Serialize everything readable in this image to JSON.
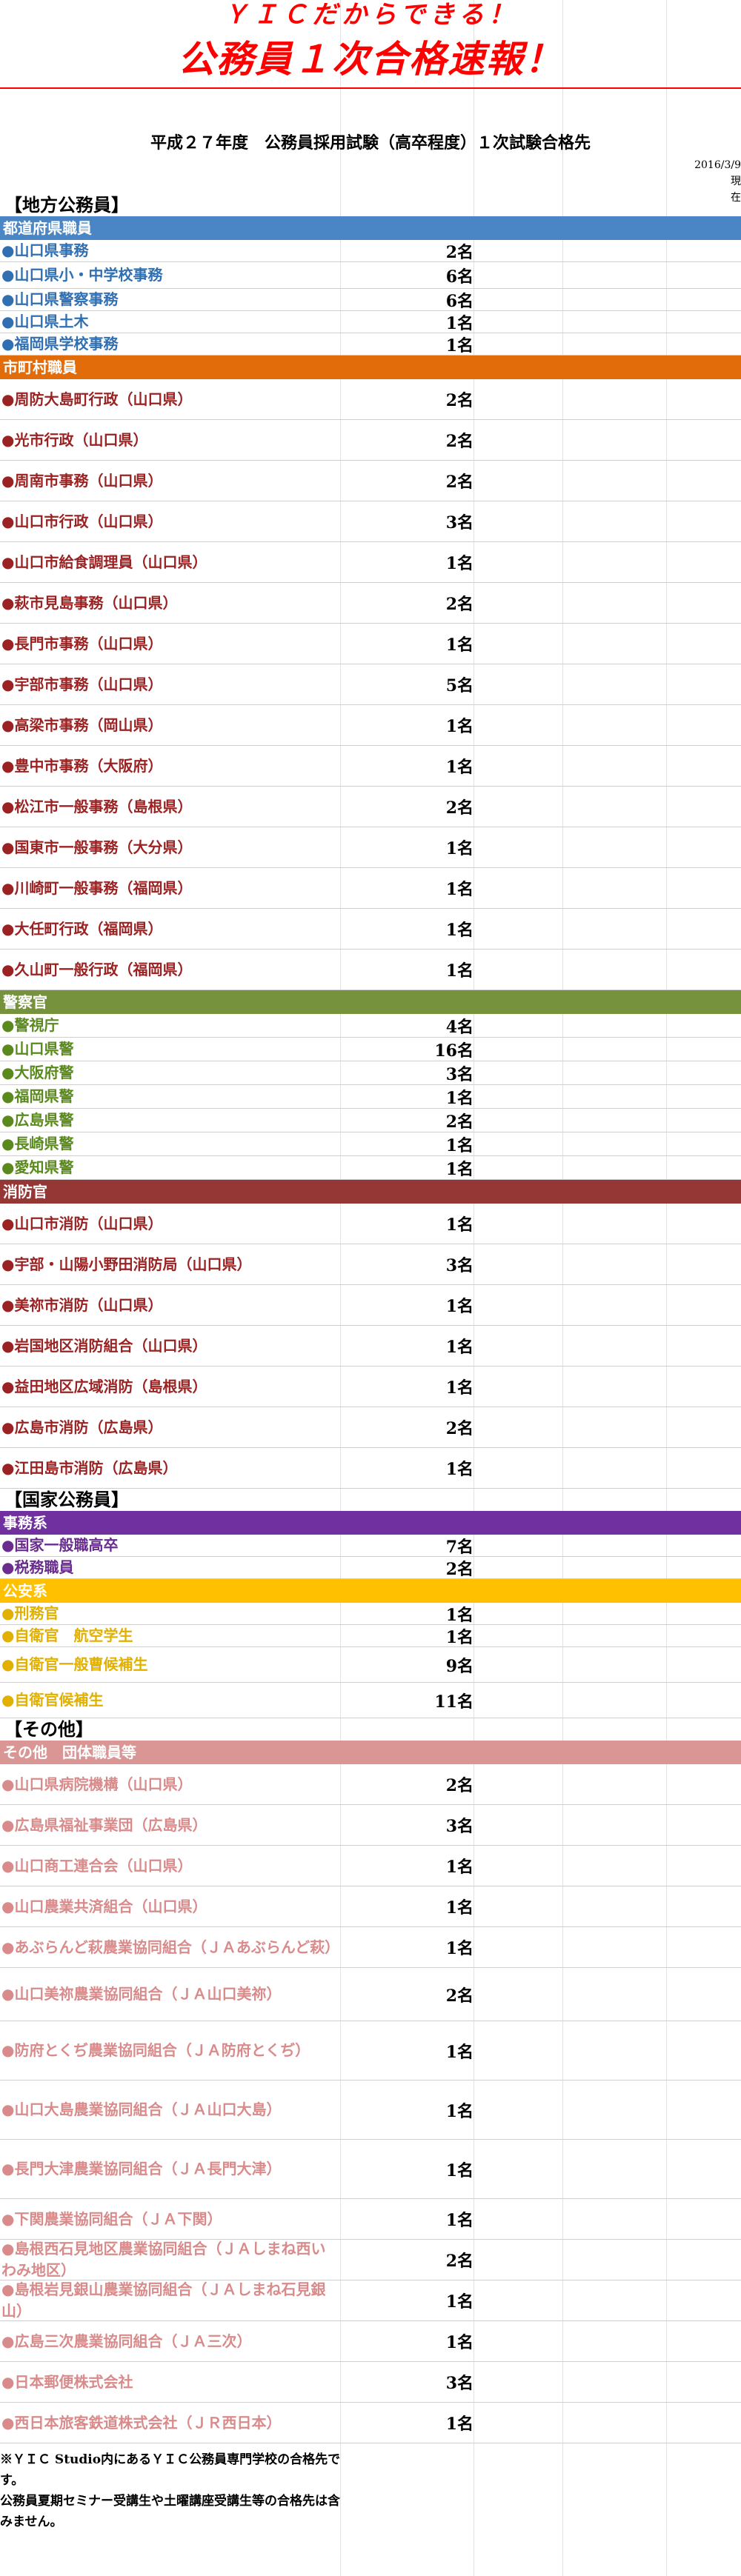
{
  "header": {
    "line1": "ＹＩＣだからできる！",
    "line2": "公務員１次合格速報！",
    "doc_title": "平成２７年度　公務員採用試験（高卒程度）１次試験合格先",
    "date_line1": "2016/3/9現",
    "date_line2": "在"
  },
  "sections": [
    {
      "type": "group",
      "label": "【地方公務員】"
    },
    {
      "type": "cat",
      "label": "都道府県職員",
      "color": "#4a86c5"
    },
    {
      "type": "row",
      "c": "c-blue",
      "name": "●山口県事務",
      "count": "2名"
    },
    {
      "type": "row",
      "c": "c-blue",
      "name": "●山口県小・中学校事務",
      "count": "6名"
    },
    {
      "type": "row",
      "c": "c-blue",
      "name": "●山口県警察事務",
      "count": "6名"
    },
    {
      "type": "row",
      "c": "c-blue",
      "name": "●山口県土木",
      "count": "1名"
    },
    {
      "type": "row",
      "c": "c-blue",
      "name": "●福岡県学校事務",
      "count": "1名"
    },
    {
      "type": "cat",
      "label": "市町村職員",
      "color": "#e26b0a"
    },
    {
      "type": "row",
      "c": "c-red",
      "name": "●周防大島町行政（山口県）",
      "count": "2名"
    },
    {
      "type": "row",
      "c": "c-red",
      "name": "●光市行政（山口県）",
      "count": "2名"
    },
    {
      "type": "row",
      "c": "c-red",
      "name": "●周南市事務（山口県）",
      "count": "2名"
    },
    {
      "type": "row",
      "c": "c-red",
      "name": "●山口市行政（山口県）",
      "count": "3名"
    },
    {
      "type": "row",
      "c": "c-red",
      "name": "●山口市給食調理員（山口県）",
      "count": "1名"
    },
    {
      "type": "row",
      "c": "c-red",
      "name": "●萩市見島事務（山口県）",
      "count": "2名"
    },
    {
      "type": "row",
      "c": "c-red",
      "name": "●長門市事務（山口県）",
      "count": "1名"
    },
    {
      "type": "row",
      "c": "c-red",
      "name": "●宇部市事務（山口県）",
      "count": "5名"
    },
    {
      "type": "row",
      "c": "c-red",
      "name": "●高梁市事務（岡山県）",
      "count": "1名"
    },
    {
      "type": "row",
      "c": "c-red",
      "name": "●豊中市事務（大阪府）",
      "count": "1名"
    },
    {
      "type": "row",
      "c": "c-red",
      "name": "●松江市一般事務（島根県）",
      "count": "2名"
    },
    {
      "type": "row",
      "c": "c-red",
      "name": "●国東市一般事務（大分県）",
      "count": "1名"
    },
    {
      "type": "row",
      "c": "c-red",
      "name": "●川崎町一般事務（福岡県）",
      "count": "1名"
    },
    {
      "type": "row",
      "c": "c-red",
      "name": "●大任町行政（福岡県）",
      "count": "1名"
    },
    {
      "type": "row",
      "c": "c-red",
      "name": "●久山町一般行政（福岡県）",
      "count": "1名"
    },
    {
      "type": "cat",
      "label": "警察官",
      "color": "#76923c"
    },
    {
      "type": "row",
      "c": "c-green",
      "name": "●警視庁",
      "count": "4名"
    },
    {
      "type": "row",
      "c": "c-green",
      "name": "●山口県警",
      "count": "16名"
    },
    {
      "type": "row",
      "c": "c-green",
      "name": "●大阪府警",
      "count": "3名"
    },
    {
      "type": "row",
      "c": "c-green",
      "name": "●福岡県警",
      "count": "1名"
    },
    {
      "type": "row",
      "c": "c-green",
      "name": "●広島県警",
      "count": "2名"
    },
    {
      "type": "row",
      "c": "c-green",
      "name": "●長崎県警",
      "count": "1名"
    },
    {
      "type": "row",
      "c": "c-green",
      "name": "●愛知県警",
      "count": "1名"
    },
    {
      "type": "cat",
      "label": "消防官",
      "color": "#953735"
    },
    {
      "type": "row",
      "c": "c-red",
      "name": "●山口市消防（山口県）",
      "count": "1名"
    },
    {
      "type": "row",
      "c": "c-red",
      "name": "●宇部・山陽小野田消防局（山口県）",
      "count": "3名"
    },
    {
      "type": "row",
      "c": "c-red",
      "name": "●美祢市消防（山口県）",
      "count": "1名"
    },
    {
      "type": "row",
      "c": "c-red",
      "name": "●岩国地区消防組合（山口県）",
      "count": "1名"
    },
    {
      "type": "row",
      "c": "c-red",
      "name": "●益田地区広域消防（島根県）",
      "count": "1名"
    },
    {
      "type": "row",
      "c": "c-red",
      "name": "●広島市消防（広島県）",
      "count": "2名"
    },
    {
      "type": "row",
      "c": "c-red",
      "name": "●江田島市消防（広島県）",
      "count": "1名"
    },
    {
      "type": "group",
      "label": "【国家公務員】"
    },
    {
      "type": "cat",
      "label": "事務系",
      "color": "#7030a0"
    },
    {
      "type": "row",
      "c": "c-purple",
      "name": "●国家一般職高卒",
      "count": "7名"
    },
    {
      "type": "row",
      "c": "c-purple",
      "name": "●税務職員",
      "count": "2名"
    },
    {
      "type": "cat",
      "label": "公安系",
      "color": "#ffc000"
    },
    {
      "type": "row",
      "c": "c-yellow",
      "name": "●刑務官",
      "count": "1名"
    },
    {
      "type": "row",
      "c": "c-yellow",
      "name": "●自衛官　航空学生",
      "count": "1名"
    },
    {
      "type": "row",
      "c": "c-yellow",
      "name": "●自衛官一般曹候補生",
      "count": "9名"
    },
    {
      "type": "row",
      "c": "c-yellow",
      "name": "●自衛官候補生",
      "count": "11名"
    },
    {
      "type": "group",
      "label": "【その他】"
    },
    {
      "type": "cat",
      "label": "その他　団体職員等",
      "color": "#da9694"
    },
    {
      "type": "row",
      "c": "c-pink",
      "name": "●山口県病院機構（山口県）",
      "count": "2名"
    },
    {
      "type": "row",
      "c": "c-pink",
      "name": "●広島県福祉事業団（広島県）",
      "count": "3名"
    },
    {
      "type": "row",
      "c": "c-pink",
      "name": "●山口商工連合会（山口県）",
      "count": "1名"
    },
    {
      "type": "row",
      "c": "c-pink",
      "name": "●山口農業共済組合（山口県）",
      "count": "1名"
    },
    {
      "type": "row",
      "c": "c-pink",
      "name": "●あぶらんど萩農業協同組合（ＪＡあぶらんど萩）",
      "count": "1名"
    },
    {
      "type": "row",
      "c": "c-pink",
      "name": "●山口美祢農業協同組合（ＪＡ山口美祢）",
      "count": "2名"
    },
    {
      "type": "row",
      "c": "c-pink",
      "name": "●防府とくぢ農業協同組合（ＪＡ防府とくぢ）",
      "count": "1名"
    },
    {
      "type": "row",
      "c": "c-pink",
      "name": "●山口大島農業協同組合（ＪＡ山口大島）",
      "count": "1名"
    },
    {
      "type": "row",
      "c": "c-pink",
      "name": "●長門大津農業協同組合（ＪＡ長門大津）",
      "count": "1名"
    },
    {
      "type": "row",
      "c": "c-pink",
      "name": "●下関農業協同組合（ＪＡ下関）",
      "count": "1名"
    },
    {
      "type": "row",
      "c": "c-pink",
      "name": "●島根西石見地区農業協同組合（ＪＡしまね西いわみ地区）",
      "count": "2名"
    },
    {
      "type": "row",
      "c": "c-pink",
      "name": "●島根岩見銀山農業協同組合（ＪＡしまね石見銀山）",
      "count": "1名"
    },
    {
      "type": "row",
      "c": "c-pink",
      "name": "●広島三次農業協同組合（ＪＡ三次）",
      "count": "1名"
    },
    {
      "type": "row",
      "c": "c-pink",
      "name": "●日本郵便株式会社",
      "count": "3名"
    },
    {
      "type": "row",
      "c": "c-pink",
      "name": "●西日本旅客鉄道株式会社（ＪＲ西日本）",
      "count": "1名"
    }
  ],
  "footer": {
    "note1": "※ＹＩＣ Studio内にあるＹＩＣ公務員専門学校の合格先です。",
    "note2": "公務員夏期セミナー受講生や土曜講座受講生等の合格先は含みません。"
  }
}
